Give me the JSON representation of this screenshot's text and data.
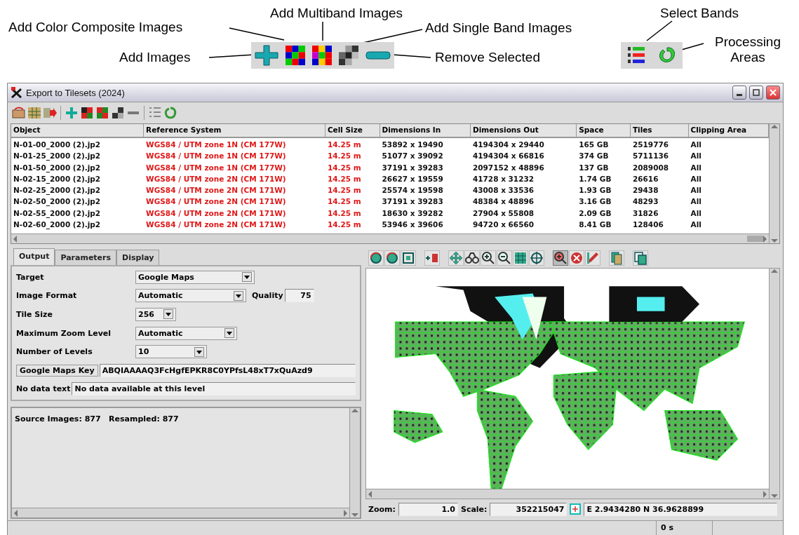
{
  "callouts": [
    {
      "label": "Add Color Composite Images"
    },
    {
      "label": "Add Multiband Images"
    },
    {
      "label": "Add Single Band Images"
    },
    {
      "label": "Add Images"
    },
    {
      "label": "Remove Selected"
    },
    {
      "label": "Select Bands"
    },
    {
      "label": "Processing Areas"
    }
  ],
  "window": {
    "title": "Export to Tilesets (2024)"
  },
  "table": {
    "columns": [
      "Object",
      "Reference System",
      "Cell Size",
      "Dimensions In",
      "Dimensions Out",
      "Space",
      "Tiles",
      "Clipping Area"
    ],
    "rows": [
      [
        "N-01-00_2000 (2).jp2",
        "WGS84 / UTM zone 1N (CM 177W)",
        "14.25 m",
        "53892 x 19490",
        "4194304 x 29440",
        "165 GB",
        "2519776",
        "All"
      ],
      [
        "N-01-25_2000 (2).jp2",
        "WGS84 / UTM zone 1N (CM 177W)",
        "14.25 m",
        "51077 x 39092",
        "4194304 x 66816",
        "374 GB",
        "5711136",
        "All"
      ],
      [
        "N-01-50_2000 (2).jp2",
        "WGS84 / UTM zone 1N (CM 177W)",
        "14.25 m",
        "37191 x 39283",
        "2097152 x 48896",
        "137 GB",
        "2089008",
        "All"
      ],
      [
        "N-02-15_2000 (2).jp2",
        "WGS84 / UTM zone 2N (CM 171W)",
        "14.25 m",
        "26627 x 19559",
        "41728 x 31232",
        "1.74 GB",
        "26616",
        "All"
      ],
      [
        "N-02-25_2000 (2).jp2",
        "WGS84 / UTM zone 2N (CM 171W)",
        "14.25 m",
        "25574 x 19598",
        "43008 x 33536",
        "1.93 GB",
        "29438",
        "All"
      ],
      [
        "N-02-50_2000 (2).jp2",
        "WGS84 / UTM zone 2N (CM 171W)",
        "14.25 m",
        "37191 x 39283",
        "48384 x 48896",
        "3.16 GB",
        "48293",
        "All"
      ],
      [
        "N-02-55_2000 (2).jp2",
        "WGS84 / UTM zone 2N (CM 171W)",
        "14.25 m",
        "18630 x 39282",
        "27904 x 55808",
        "2.09 GB",
        "31826",
        "All"
      ],
      [
        "N-02-60_2000 (2).jp2",
        "WGS84 / UTM zone 2N (CM 171W)",
        "14.25 m",
        "53946 x 39606",
        "94720 x 66560",
        "8.41 GB",
        "128406",
        "All"
      ]
    ]
  },
  "tabs": [
    {
      "label": "Output",
      "selected": true
    },
    {
      "label": "Parameters",
      "selected": false
    },
    {
      "label": "Display",
      "selected": false
    }
  ],
  "fields": [
    {
      "kind": "select",
      "label": "Target",
      "value": "Google Maps"
    },
    {
      "kind": "select",
      "label": "Image Format",
      "value": "Automatic",
      "extra_label": "Quality",
      "extra_value": "75"
    },
    {
      "kind": "select",
      "label": "Tile Size",
      "value": "256"
    },
    {
      "kind": "select",
      "label": "Maximum Zoom Level",
      "value": "Automatic"
    },
    {
      "kind": "select",
      "label": "Number of Levels",
      "value": "10"
    },
    {
      "kind": "button_field",
      "label": "Google Maps Key",
      "value": "ABQIAAAAQ3FcHgfEPKR8C0YPfsL48xT7xQuAzd9"
    },
    {
      "kind": "field",
      "label": "No data text",
      "value": "No data available at this level"
    }
  ],
  "log": {
    "text": "Source Images: 877   Resampled: 877"
  },
  "map_status": {
    "zoom_label": "Zoom:",
    "zoom": "1.0",
    "scale_label": "Scale:",
    "scale": "352215047",
    "coordinates": "E 2.9434280  N 36.9628899"
  },
  "status_bar": {
    "time": "0 s"
  }
}
